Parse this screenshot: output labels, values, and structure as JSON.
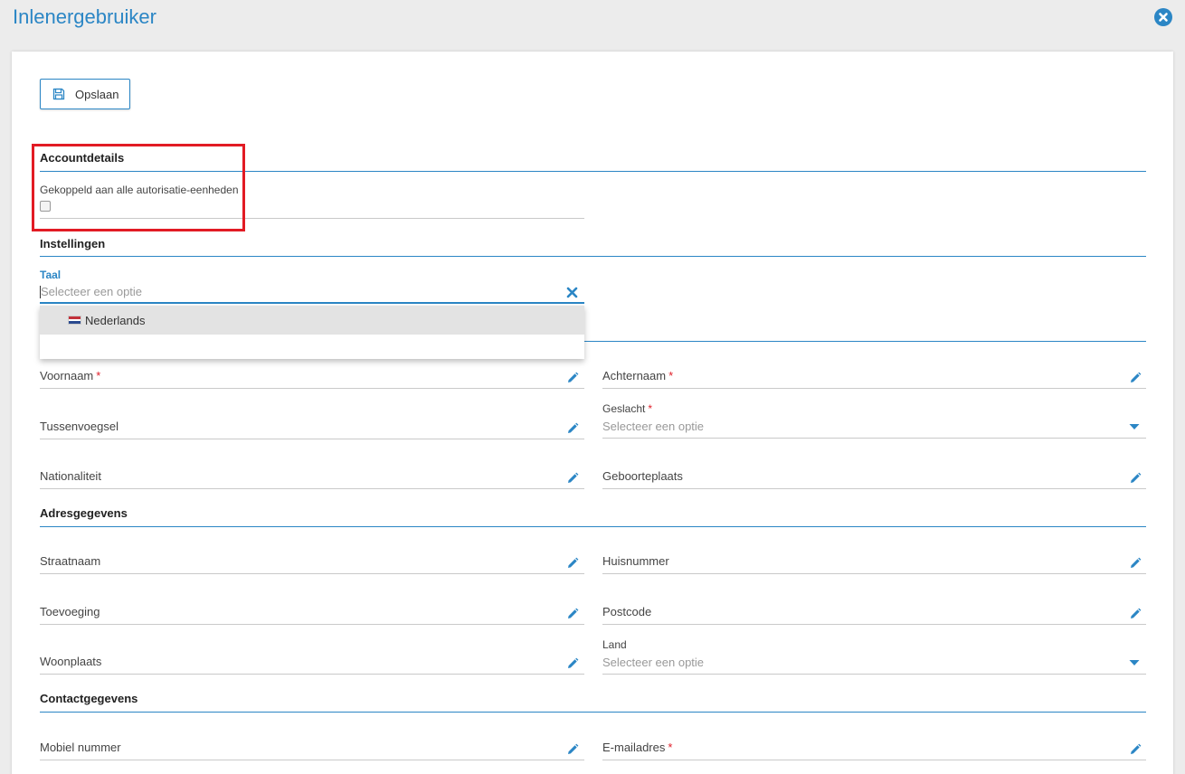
{
  "app": {
    "title": "Inlenergebruiker"
  },
  "toolbar": {
    "save_label": "Opslaan"
  },
  "sections": {
    "account": {
      "title": "Accountdetails",
      "linked_label": "Gekoppeld aan alle autorisatie-eenheden",
      "linked_checked": false
    },
    "settings": {
      "title": "Instellingen",
      "language_label": "Taal",
      "language_placeholder": "Selecteer een optie",
      "language_options": [
        "Nederlands"
      ]
    },
    "personal": {
      "first_name_label": "Voornaam",
      "last_name_label": "Achternaam",
      "infix_label": "Tussenvoegsel",
      "gender_label": "Geslacht",
      "gender_placeholder": "Selecteer een optie",
      "nationality_label": "Nationaliteit",
      "birthplace_label": "Geboorteplaats"
    },
    "address": {
      "title": "Adresgegevens",
      "street_label": "Straatnaam",
      "house_number_label": "Huisnummer",
      "addition_label": "Toevoeging",
      "postcode_label": "Postcode",
      "city_label": "Woonplaats",
      "country_label": "Land",
      "country_placeholder": "Selecteer een optie"
    },
    "contact": {
      "title": "Contactgegevens",
      "mobile_label": "Mobiel nummer",
      "email_label": "E-mailadres"
    }
  },
  "required_marker": "*",
  "colors": {
    "accent": "#2b86c5",
    "required": "#e0202a",
    "highlight": "#e21b24"
  }
}
